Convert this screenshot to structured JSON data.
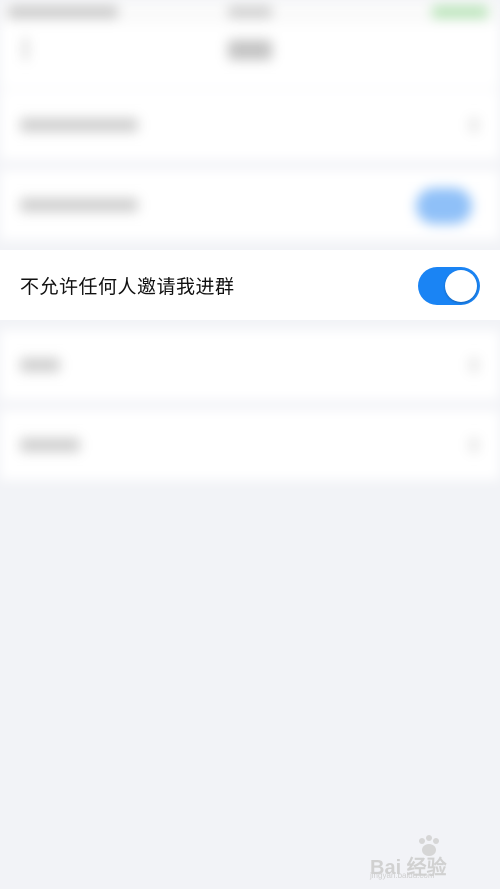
{
  "focus_row": {
    "label": "不允许任何人邀请我进群",
    "toggle_on": true
  },
  "colors": {
    "accent": "#1a84f4",
    "background": "#f2f3f7",
    "row_background": "#ffffff"
  },
  "watermark": {
    "main": "Bai 经验",
    "sub": "jingyan.baidu.com"
  },
  "icons": {
    "back": "chevron-left-icon",
    "paw": "paw-icon"
  }
}
